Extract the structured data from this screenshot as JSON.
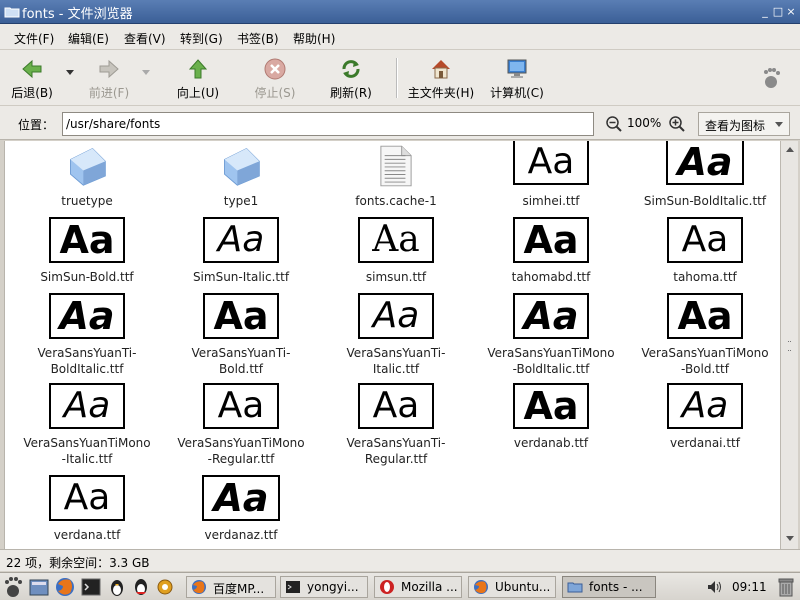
{
  "window": {
    "title": "fonts - 文件浏览器",
    "controls": {
      "minimize": "_",
      "maximize": "□",
      "close": "×"
    }
  },
  "menu": [
    "文件(F)",
    "编辑(E)",
    "查看(V)",
    "转到(G)",
    "书签(B)",
    "帮助(H)"
  ],
  "toolbar": {
    "back": "后退(B)",
    "forward": "前进(F)",
    "up": "向上(U)",
    "stop": "停止(S)",
    "reload": "刷新(R)",
    "home": "主文件夹(H)",
    "computer": "计算机(C)"
  },
  "location": {
    "label": "位置：",
    "path": "/usr/share/fonts",
    "zoom": "100%",
    "view_mode": "查看为图标"
  },
  "files": [
    {
      "name": "truetype",
      "kind": "folder"
    },
    {
      "name": "type1",
      "kind": "folder"
    },
    {
      "name": "fonts.cache-1",
      "kind": "text"
    },
    {
      "name": "simhei.ttf",
      "kind": "font",
      "style": "norm",
      "preview": "Aa"
    },
    {
      "name": "SimSun-BoldItalic.ttf",
      "kind": "font",
      "style": "bi",
      "preview": "Aa"
    },
    {
      "name": "SimSun-Bold.ttf",
      "kind": "font",
      "style": "bold",
      "preview": "Aa"
    },
    {
      "name": "SimSun-Italic.ttf",
      "kind": "font",
      "style": "it",
      "preview": "Aa"
    },
    {
      "name": "simsun.ttf",
      "kind": "font",
      "style": "serif",
      "preview": "Aa"
    },
    {
      "name": "tahomabd.ttf",
      "kind": "font",
      "style": "bold",
      "preview": "Aa"
    },
    {
      "name": "tahoma.ttf",
      "kind": "font",
      "style": "norm",
      "preview": "Aa"
    },
    {
      "name": "VeraSansYuanTi-BoldItalic.ttf",
      "line1": "VeraSansYuanTi-",
      "line2": "BoldItalic.ttf",
      "kind": "font",
      "style": "bi",
      "preview": "Aa"
    },
    {
      "name": "VeraSansYuanTi-Bold.ttf",
      "line1": "VeraSansYuanTi-",
      "line2": "Bold.ttf",
      "kind": "font",
      "style": "bold",
      "preview": "Aa"
    },
    {
      "name": "VeraSansYuanTi-Italic.ttf",
      "line1": "VeraSansYuanTi-",
      "line2": "Italic.ttf",
      "kind": "font",
      "style": "it",
      "preview": "Aa"
    },
    {
      "name": "VeraSansYuanTiMono-BoldItalic.ttf",
      "line1": "VeraSansYuanTiMono",
      "line2": "-BoldItalic.ttf",
      "kind": "font",
      "style": "bi",
      "preview": "Aa"
    },
    {
      "name": "VeraSansYuanTiMono-Bold.ttf",
      "line1": "VeraSansYuanTiMono",
      "line2": "-Bold.ttf",
      "kind": "font",
      "style": "bold",
      "preview": "Aa"
    },
    {
      "name": "VeraSansYuanTiMono-Italic.ttf",
      "line1": "VeraSansYuanTiMono",
      "line2": "-Italic.ttf",
      "kind": "font",
      "style": "it",
      "preview": "Aa"
    },
    {
      "name": "VeraSansYuanTiMono-Regular.ttf",
      "line1": "VeraSansYuanTiMono",
      "line2": "-Regular.ttf",
      "kind": "font",
      "style": "norm",
      "preview": "Aa"
    },
    {
      "name": "VeraSansYuanTi-Regular.ttf",
      "line1": "VeraSansYuanTi-",
      "line2": "Regular.ttf",
      "kind": "font",
      "style": "norm",
      "preview": "Aa"
    },
    {
      "name": "verdanab.ttf",
      "kind": "font",
      "style": "bold",
      "preview": "Aa"
    },
    {
      "name": "verdanai.ttf",
      "kind": "font",
      "style": "it",
      "preview": "Aa"
    },
    {
      "name": "verdana.ttf",
      "kind": "font",
      "style": "norm",
      "preview": "Aa"
    },
    {
      "name": "verdanaz.ttf",
      "kind": "font",
      "style": "bi",
      "preview": "Aa"
    }
  ],
  "status": "22 项，剩余空间：3.3 GB",
  "taskbar": {
    "tasks": [
      {
        "label": "百度MP...",
        "icon": "firefox-icon"
      },
      {
        "label": "yongyi...",
        "icon": "terminal-icon"
      },
      {
        "label": "Mozilla ...",
        "icon": "opera-icon"
      },
      {
        "label": "Ubuntu...",
        "icon": "firefox-icon"
      },
      {
        "label": "fonts - ...",
        "icon": "folder-icon",
        "active": true
      }
    ],
    "clock": "09:11"
  }
}
